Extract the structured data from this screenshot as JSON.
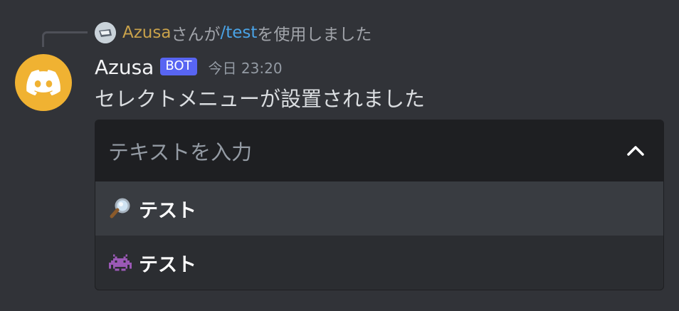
{
  "reply": {
    "name": "Azusa",
    "middle": "さんが",
    "command": "/test",
    "rest": "を使用しました"
  },
  "message": {
    "username": "Azusa",
    "bot_tag": "BOT",
    "timestamp": "今日 23:20",
    "text": "セレクトメニューが設置されました"
  },
  "select": {
    "placeholder": "テキストを入力",
    "options": [
      {
        "icon": "magnifying-glass-icon",
        "label": "テスト",
        "highlighted": true
      },
      {
        "icon": "space-invader-icon",
        "label": "テスト",
        "highlighted": false
      }
    ]
  },
  "colors": {
    "background": "#313338",
    "avatar": "#f0b232",
    "bot_tag": "#5865f2",
    "reply_name": "#c9a24b",
    "command": "#4aa3e6",
    "select_head": "#1e1f22",
    "option_hover": "#393c41"
  }
}
